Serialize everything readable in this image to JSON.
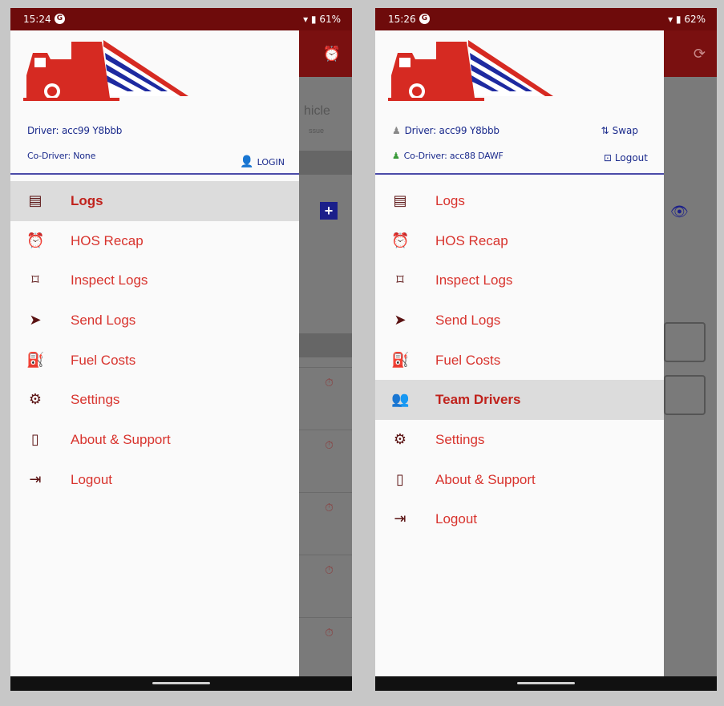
{
  "left": {
    "status": {
      "time": "15:24",
      "battery": "61%"
    },
    "driver_line": "Driver: acc99 Y8bbb",
    "codriver_line": "Co-Driver: None",
    "login_label": "LOGIN",
    "bg": {
      "title_fragment": "hicle",
      "sub_fragment": "ssue",
      "plus": "+"
    },
    "menu": [
      {
        "label": "Logs",
        "icon": "logbook-icon",
        "glyph": "▤"
      },
      {
        "label": "HOS Recap",
        "icon": "alarm-clock-icon",
        "glyph": "⏰"
      },
      {
        "label": "Inspect Logs",
        "icon": "inspect-icon",
        "glyph": "⌑"
      },
      {
        "label": "Send Logs",
        "icon": "send-icon",
        "glyph": "➤"
      },
      {
        "label": "Fuel Costs",
        "icon": "fuel-pump-icon",
        "glyph": "⛽"
      },
      {
        "label": "Settings",
        "icon": "gear-icon",
        "glyph": "⚙"
      },
      {
        "label": "About & Support",
        "icon": "phone-icon",
        "glyph": "▯"
      },
      {
        "label": "Logout",
        "icon": "logout-icon",
        "glyph": "⇥"
      }
    ]
  },
  "right": {
    "status": {
      "time": "15:26",
      "battery": "62%"
    },
    "driver_line": "Driver: acc99 Y8bbb",
    "codriver_line": "Co-Driver: acc88 DAWF",
    "swap_label": "Swap",
    "logout_action_label": "Logout",
    "menu": [
      {
        "label": "Logs",
        "icon": "logbook-icon",
        "glyph": "▤"
      },
      {
        "label": "HOS Recap",
        "icon": "alarm-clock-icon",
        "glyph": "⏰"
      },
      {
        "label": "Inspect Logs",
        "icon": "inspect-icon",
        "glyph": "⌑"
      },
      {
        "label": "Send Logs",
        "icon": "send-icon",
        "glyph": "➤"
      },
      {
        "label": "Fuel Costs",
        "icon": "fuel-pump-icon",
        "glyph": "⛽"
      },
      {
        "label": "Team Drivers",
        "icon": "team-icon",
        "glyph": "👥"
      },
      {
        "label": "Settings",
        "icon": "gear-icon",
        "glyph": "⚙"
      },
      {
        "label": "About & Support",
        "icon": "phone-icon",
        "glyph": "▯"
      },
      {
        "label": "Logout",
        "icon": "logout-icon",
        "glyph": "⇥"
      }
    ]
  },
  "colors": {
    "brand_red": "#d8332d",
    "status_bar": "#6e0b0b",
    "navy": "#1a2a8c"
  }
}
